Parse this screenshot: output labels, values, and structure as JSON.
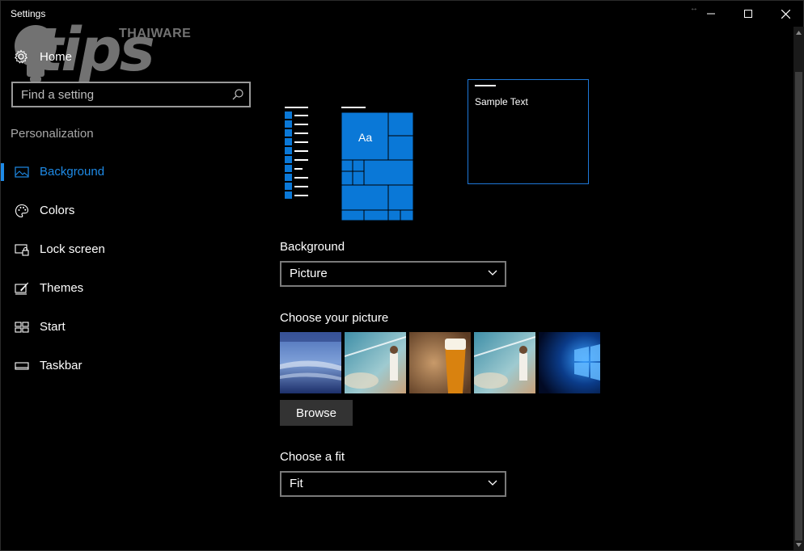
{
  "window": {
    "title": "Settings"
  },
  "watermark": {
    "word": "tips",
    "brand": "THAIWARE"
  },
  "sidebar": {
    "home_label": "Home",
    "search_placeholder": "Find a setting",
    "section_label": "Personalization",
    "items": [
      {
        "label": "Background",
        "icon": "picture-icon",
        "active": true
      },
      {
        "label": "Colors",
        "icon": "palette-icon",
        "active": false
      },
      {
        "label": "Lock screen",
        "icon": "lock-screen-icon",
        "active": false
      },
      {
        "label": "Themes",
        "icon": "brush-icon",
        "active": false
      },
      {
        "label": "Start",
        "icon": "start-icon",
        "active": false
      },
      {
        "label": "Taskbar",
        "icon": "taskbar-icon",
        "active": false
      }
    ]
  },
  "main": {
    "preview": {
      "sample_text": "Sample Text",
      "tile_text": "Aa"
    },
    "background_label": "Background",
    "background_value": "Picture",
    "choose_picture_label": "Choose your picture",
    "thumbnails": [
      {
        "name": "ocean-city-wallpaper"
      },
      {
        "name": "anime-girl-sky-wallpaper"
      },
      {
        "name": "beer-glass-wallpaper"
      },
      {
        "name": "anime-girl-sky-wallpaper-2"
      },
      {
        "name": "windows-10-logo-wallpaper"
      }
    ],
    "browse_label": "Browse",
    "fit_label": "Choose a fit",
    "fit_value": "Fit"
  },
  "colors": {
    "accent": "#1e8ae6",
    "tile": "#0a78d7",
    "background": "#000000"
  }
}
